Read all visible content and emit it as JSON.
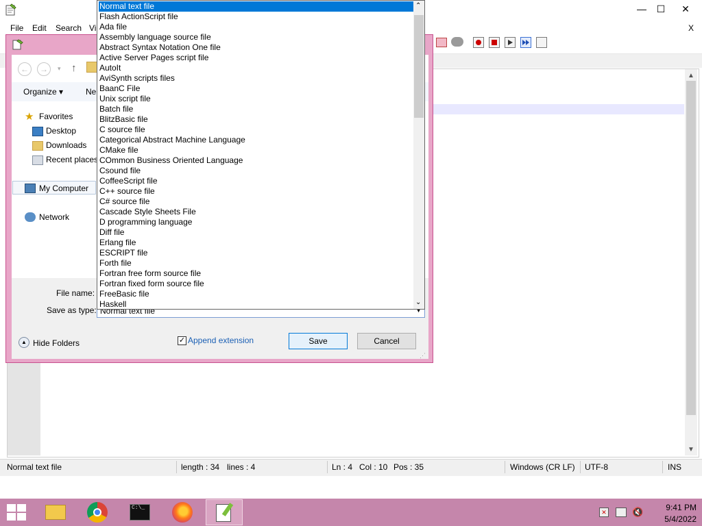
{
  "window": {
    "minimize_glyph": "—",
    "maximize_glyph": "☐",
    "close_glyph": "✕",
    "doc_close_glyph": "X"
  },
  "menu": [
    "File",
    "Edit",
    "Search",
    "Vi"
  ],
  "dialog": {
    "nav_back_icon": "arrow-left-icon",
    "organize_label": "Organize ▾",
    "new_folder_label": "Ne",
    "nav_items": {
      "favorites": "Favorites",
      "desktop": "Desktop",
      "downloads": "Downloads",
      "recent_places": "Recent places",
      "my_computer": "My Computer",
      "network": "Network"
    },
    "file_name_label": "File name:",
    "save_as_type_label": "Save as type:",
    "save_as_type_value": "Normal text file",
    "hide_folders_label": "Hide Folders",
    "append_extension_label": "Append extension",
    "append_extension_checked": true,
    "save_label": "Save",
    "cancel_label": "Cancel",
    "file_types": [
      "Normal text file",
      "Flash ActionScript file",
      "Ada file",
      "Assembly language source file",
      "Abstract Syntax Notation One file",
      "Active Server Pages script file",
      "AutoIt",
      "AviSynth scripts files",
      "BaanC File",
      "Unix script file",
      "Batch file",
      "BlitzBasic file",
      "C source file",
      "Categorical Abstract Machine Language",
      "CMake file",
      "COmmon Business Oriented Language",
      "Csound file",
      "CoffeeScript file",
      "C++ source file",
      "C# source file",
      "Cascade Style Sheets File",
      "D programming language",
      "Diff file",
      "Erlang file",
      "ESCRIPT file",
      "Forth file",
      "Fortran free form source file",
      "Fortran fixed form source file",
      "FreeBasic file",
      "Haskell"
    ],
    "selected_type_index": 0
  },
  "statusbar": {
    "lang": "Normal text file",
    "length": "length : 34",
    "lines": "lines : 4",
    "ln": "Ln : 4",
    "col": "Col : 10",
    "pos": "Pos : 35",
    "eol": "Windows (CR LF)",
    "encoding": "UTF-8",
    "mode": "INS"
  },
  "taskbar": {
    "time": "9:41 PM",
    "date": "5/4/2022",
    "apps": [
      "file-explorer-icon",
      "chrome-icon",
      "command-prompt-icon",
      "firefox-icon",
      "notepadpp-icon"
    ]
  },
  "colors": {
    "dialog_frame": "#e8a6c8",
    "taskbar": "#c586ab",
    "selection": "#0078d7"
  }
}
